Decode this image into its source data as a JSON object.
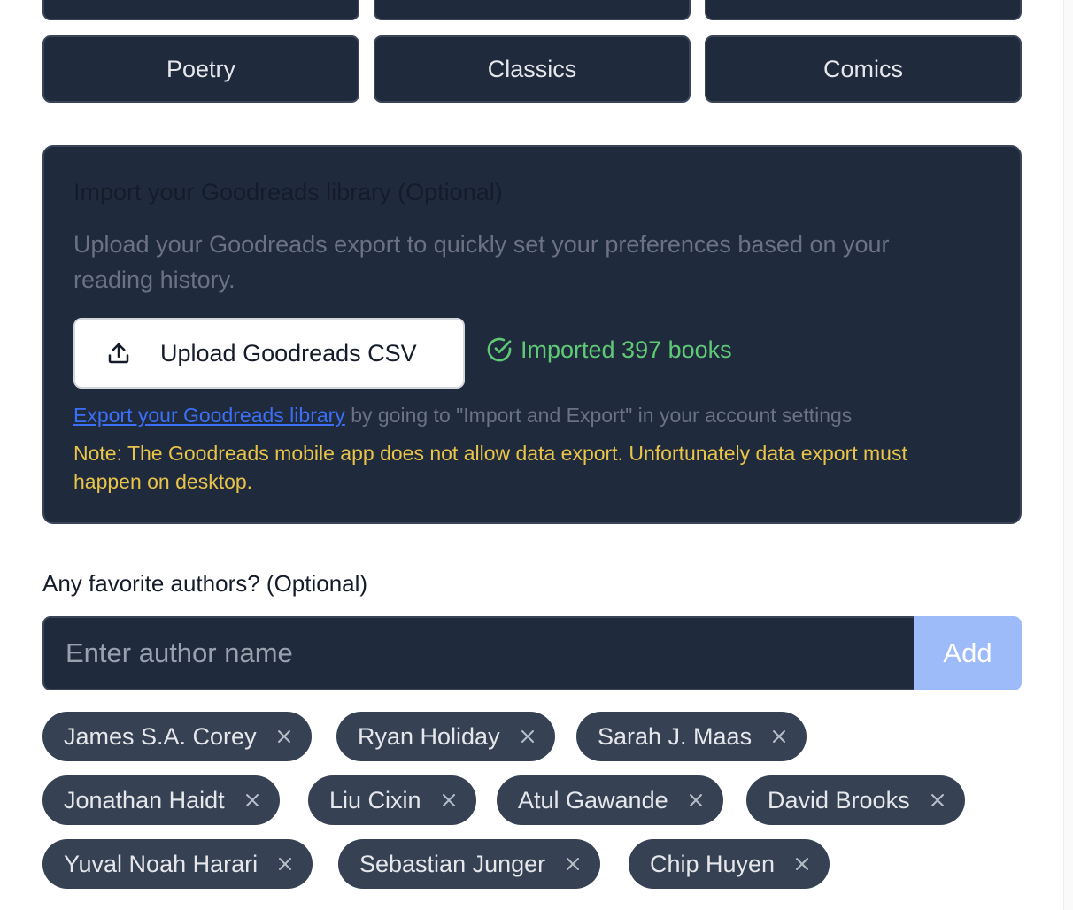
{
  "genres": {
    "row1": [
      "",
      "",
      ""
    ],
    "row2": [
      "Poetry",
      "Classics",
      "Comics"
    ]
  },
  "import_card": {
    "title": "Import your Goodreads library (Optional)",
    "description": "Upload your Goodreads export to quickly set your preferences based on your reading history.",
    "upload_button_label": "Upload Goodreads CSV",
    "upload_icon": "upload-icon",
    "status_icon": "check-circle-icon",
    "status_text": "Imported 397 books",
    "export_link_text": "Export your Goodreads library",
    "export_suffix": " by going to \"Import and Export\" in your account settings",
    "note": "Note: The Goodreads mobile app does not allow data export. Unfortunately data export must happen on desktop."
  },
  "authors": {
    "label": "Any favorite authors? (Optional)",
    "input_value": "",
    "input_placeholder": "Enter author name",
    "add_label": "Add",
    "remove_icon": "close-icon",
    "chips": [
      "James S.A. Corey",
      "Ryan Holiday",
      "Sarah J. Maas",
      "Jonathan Haidt",
      "Liu Cixin",
      "Atul Gawande",
      "David Brooks",
      "Yuval Noah Harari",
      "Sebastian Junger",
      "Chip Huyen"
    ]
  },
  "colors": {
    "panel_bg": "#202a3d",
    "chip_bg": "#364153",
    "success": "#5fca76",
    "warning": "#e8c449",
    "link": "#3b6ff5",
    "add_button": "#9dbbf8"
  }
}
